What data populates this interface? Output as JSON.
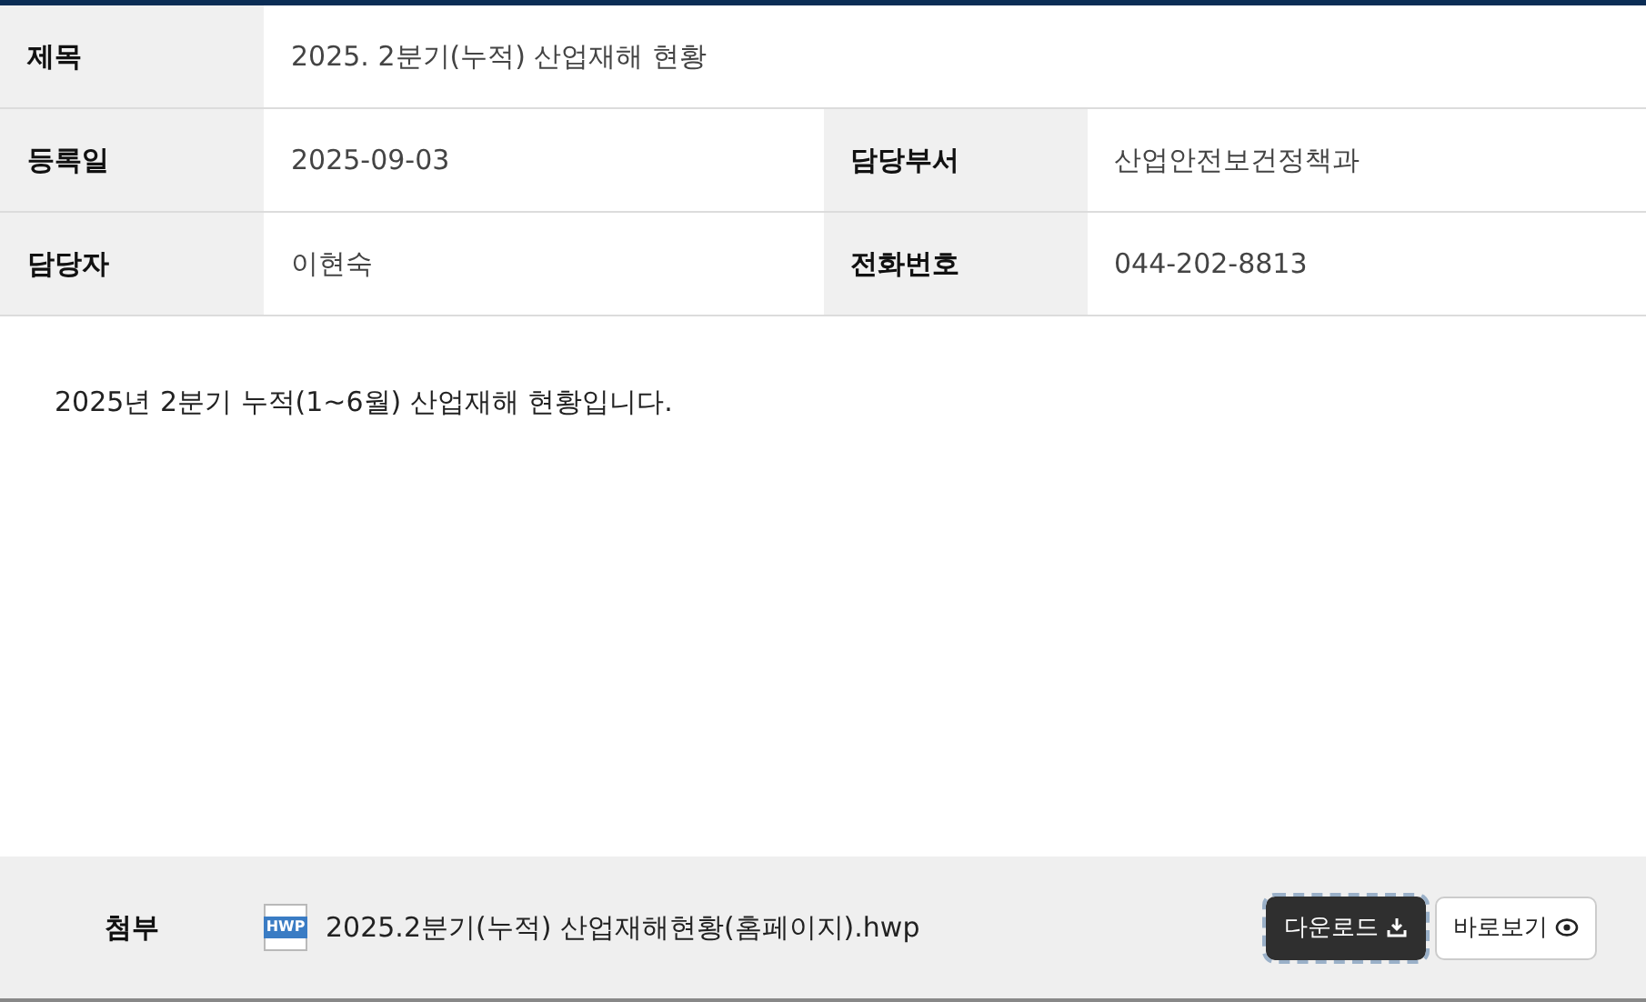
{
  "title_row": {
    "label": "제목",
    "value": "2025. 2분기(누적) 산업재해 현황"
  },
  "info_rows": [
    [
      {
        "label": "등록일",
        "value": "2025-09-03"
      },
      {
        "label": "담당부서",
        "value": "산업안전보건정책과"
      }
    ],
    [
      {
        "label": "담당자",
        "value": "이현숙"
      },
      {
        "label": "전화번호",
        "value": "044-202-8813"
      }
    ]
  ],
  "body": "2025년 2분기 누적(1~6월) 산업재해 현황입니다.",
  "attachment": {
    "label": "첨부",
    "file_type": "HWP",
    "file_name": "2025.2분기(누적) 산업재해현황(홈페이지).hwp",
    "buttons": [
      {
        "kind": "download",
        "label": "다운로드",
        "focused": true
      },
      {
        "kind": "preview",
        "label": "바로보기",
        "focused": false
      }
    ]
  }
}
